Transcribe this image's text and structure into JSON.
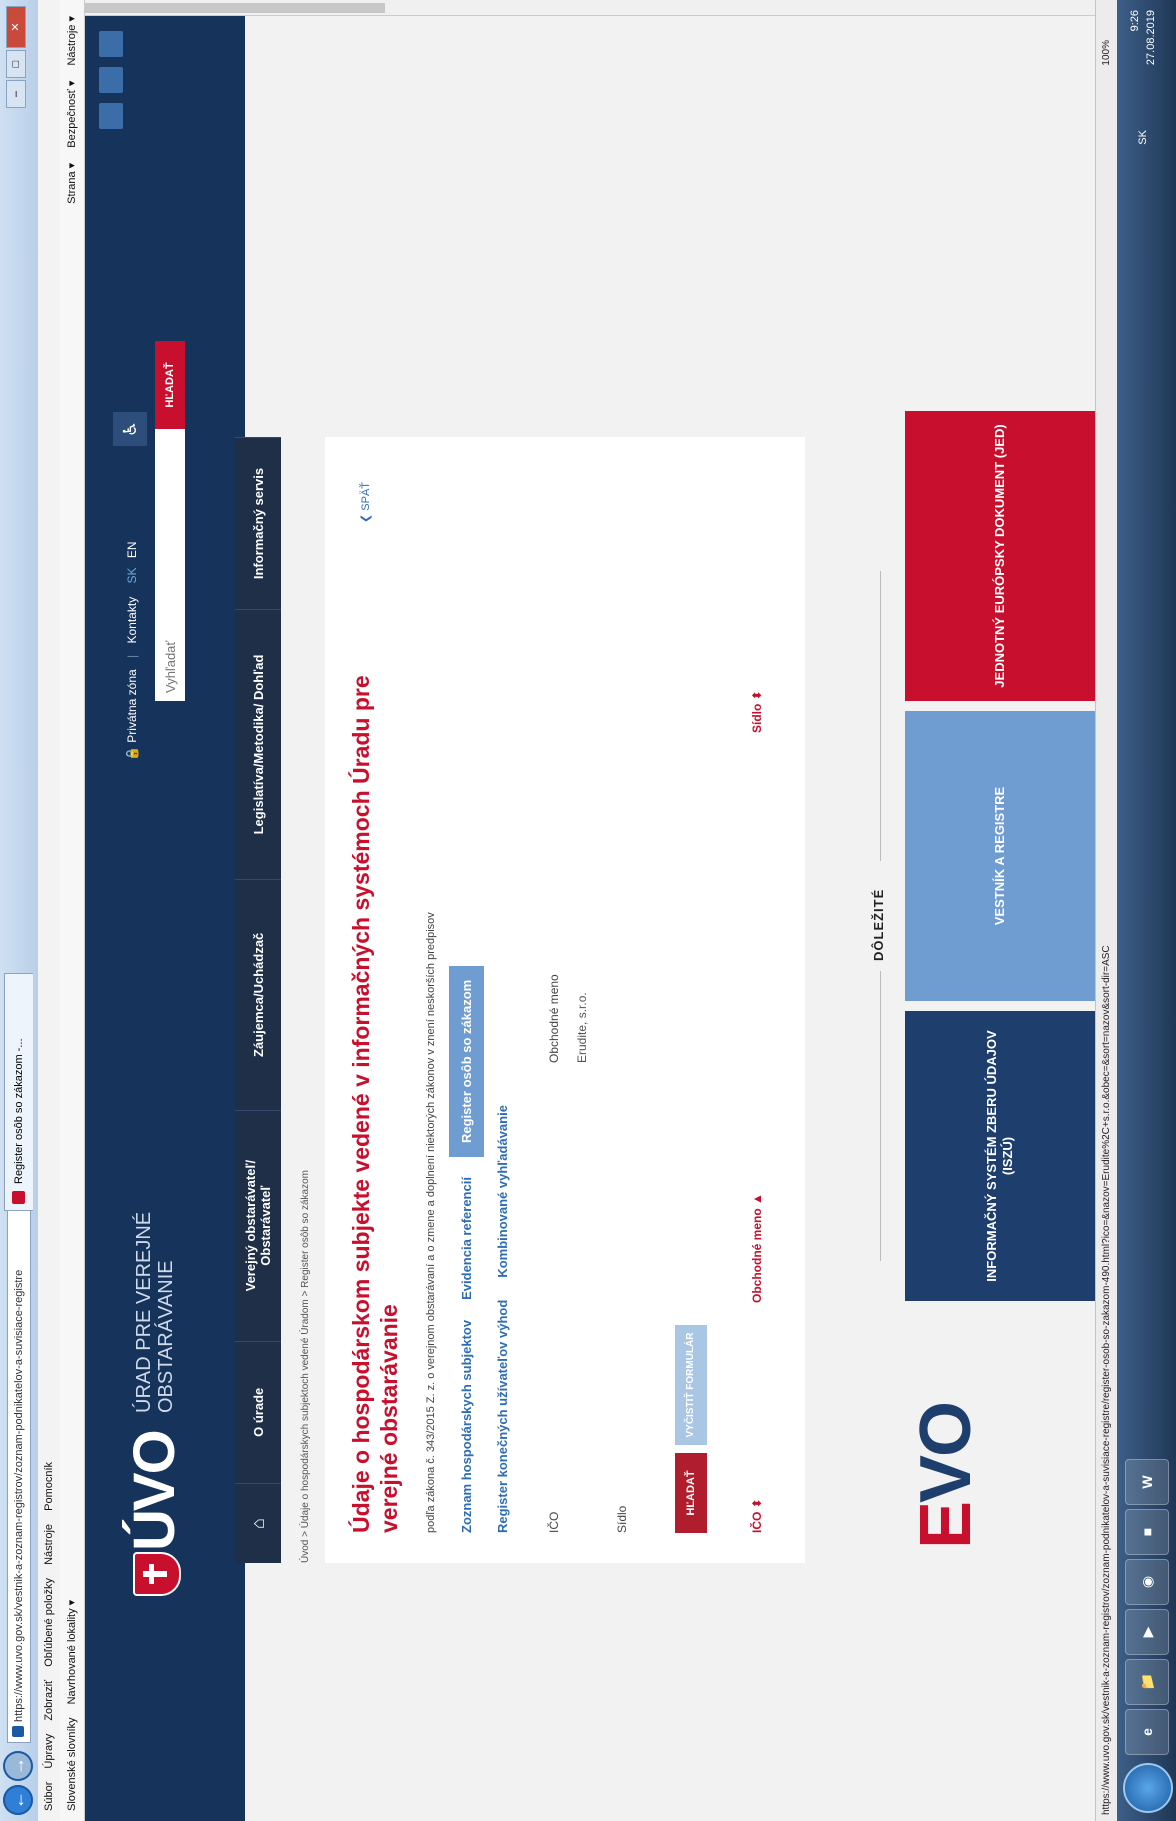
{
  "browser": {
    "address": "https://www.uvo.gov.sk/vestnik-a-zoznam-registrov/zoznam-podnikatelov-a-suvisiace-registre",
    "tab_title": "Register osôb so zákazom -...",
    "menu": [
      "Súbor",
      "Úpravy",
      "Zobraziť",
      "Obľúbené položky",
      "Nástroje",
      "Pomocník"
    ],
    "favorites": [
      "Slovenské slovníky",
      "Navrhované lokality ▾"
    ],
    "commands": [
      "Strana ▾",
      "Bezpečnosť ▾",
      "Nástroje ▾"
    ],
    "status_url": "https://www.uvo.gov.sk/vestnik-a-zoznam-registrov/zoznam-podnikatelov-a-suvisiace-registre/register-osob-so-zakazom-490.html?ico=&nazov=Erudite%2C+s.r.o.&obec=&sort=nazov&sort-dir=ASC",
    "zoom": "100%"
  },
  "header": {
    "logo_text": "ÚVO",
    "logo_sub": "ÚRAD PRE VEREJNÉ OBSTARÁVANIE",
    "private_zone": "Privátna zóna",
    "contacts": "Kontakty",
    "lang_sk": "SK",
    "lang_en": "EN",
    "search_placeholder": "Vyhľadať",
    "search_button": "HĽADAŤ"
  },
  "nav": {
    "home_icon": "home-icon",
    "items": [
      "O úrade",
      "Verejný obstarávateľ/ Obstarávateľ",
      "Záujemca/Uchádzač",
      "Legislatíva/Metodika/ Dohľad",
      "Informačný servis"
    ]
  },
  "breadcrumb": "Úvod  >  Údaje o hospodárskych subjektoch vedené Úradom  >  Register osôb so zákazom",
  "content": {
    "title": "Údaje o hospodárskom subjekte vedené v informačných systémoch Úradu pre verejné obstarávanie",
    "back": "SPÄŤ",
    "subtitle": "podľa zákona č. 343/2015 Z. z. o verejnom obstarávaní a o zmene a doplnení niektorých zákonov v znení neskorších predpisov",
    "tabs_row1": [
      "Zoznam hospodárskych subjektov",
      "Evidencia referencií",
      "Register osôb so zákazom"
    ],
    "tabs_row2": [
      "Register konečných užívateľov výhod",
      "Kombinované vyhľadávanie"
    ],
    "form": {
      "ico_label": "IČO",
      "name_label": "Obchodné meno",
      "name_value": "Erudite, s.r.o.",
      "seat_label": "Sídlo"
    },
    "buttons": {
      "search": "HĽADAŤ",
      "clear": "VYČISTIŤ FORMULÁR"
    },
    "columns": [
      "IČO ⬍",
      "Obchodné meno ▲",
      "Sídlo ⬍"
    ]
  },
  "footer": {
    "heading": "DÔLEŽITÉ",
    "logo": "EVO",
    "tiles": [
      "INFORMAČNÝ SYSTÉM ZBERU ÚDAJOV (ISZÚ)",
      "VESTNÍK A REGISTRE",
      "JEDNOTNÝ EURÓPSKY DOKUMENT (JED)"
    ]
  },
  "taskbar": {
    "lang": "SK",
    "time": "9:26",
    "date": "27.08.2019"
  },
  "colors": {
    "header_bg": "#16335b",
    "accent_red": "#c8102e",
    "link_blue": "#2d6db5",
    "tile_blue_dark": "#1e3f6e",
    "tile_blue_light": "#6f9cd1"
  }
}
